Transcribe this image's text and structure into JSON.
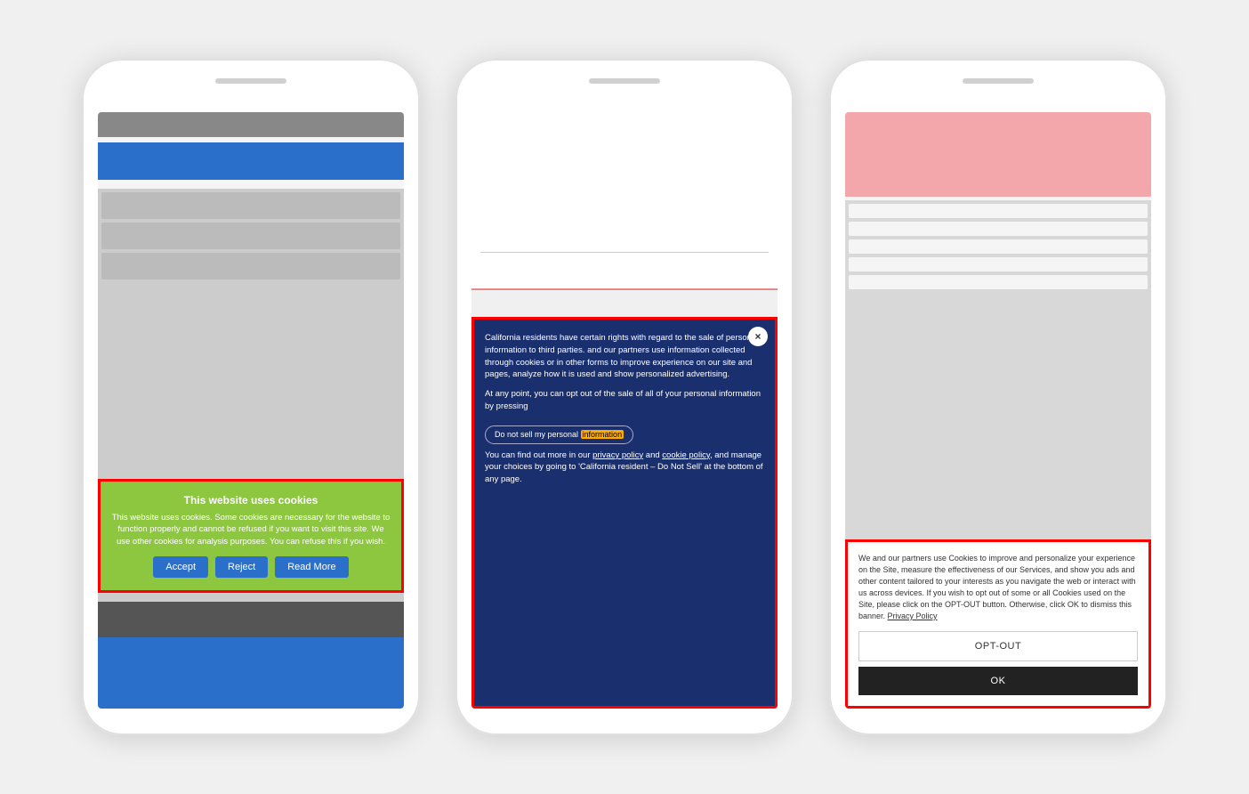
{
  "phone1": {
    "cookie_banner": {
      "title": "This website uses cookies",
      "description": "This website uses cookies. Some cookies are necessary for the website to function properly and cannot be refused if you want to visit this site. We use other cookies for analysis purposes. You can refuse this if you wish.",
      "accept_label": "Accept",
      "reject_label": "Reject",
      "read_more_label": "Read More"
    }
  },
  "phone2": {
    "cookie_banner": {
      "close_icon": "×",
      "paragraph1": "California residents have certain rights with regard to the sale of personal information to third parties.",
      "paragraph1b": "and our partners use information collected through cookies or in other forms to improve experience on our site and pages, analyze how it is used and show personalized advertising.",
      "paragraph2": "At any point, you can opt out of the sale of all of your personal information by pressing",
      "opt_out_label": "Do not sell my personal information",
      "opt_out_highlight": "information",
      "paragraph3_prefix": "You can find out more in our",
      "privacy_policy": "privacy policy",
      "and": "and",
      "cookie_policy": "cookie policy",
      "paragraph3_suffix": ", and manage your choices by going to 'California resident – Do Not Sell' at the bottom of any page."
    }
  },
  "phone3": {
    "cookie_banner": {
      "description": "We and our partners use Cookies to improve and personalize your experience on the Site, measure the effectiveness of our Services, and show you ads and other content tailored to your interests as you navigate the web or interact with us across devices. If you wish to opt out of some or all Cookies used on the Site, please click on the OPT-OUT button. Otherwise, click OK to dismiss this banner.",
      "privacy_policy_link": "Privacy Policy",
      "opt_out_label": "OPT-OUT",
      "ok_label": "OK"
    }
  }
}
